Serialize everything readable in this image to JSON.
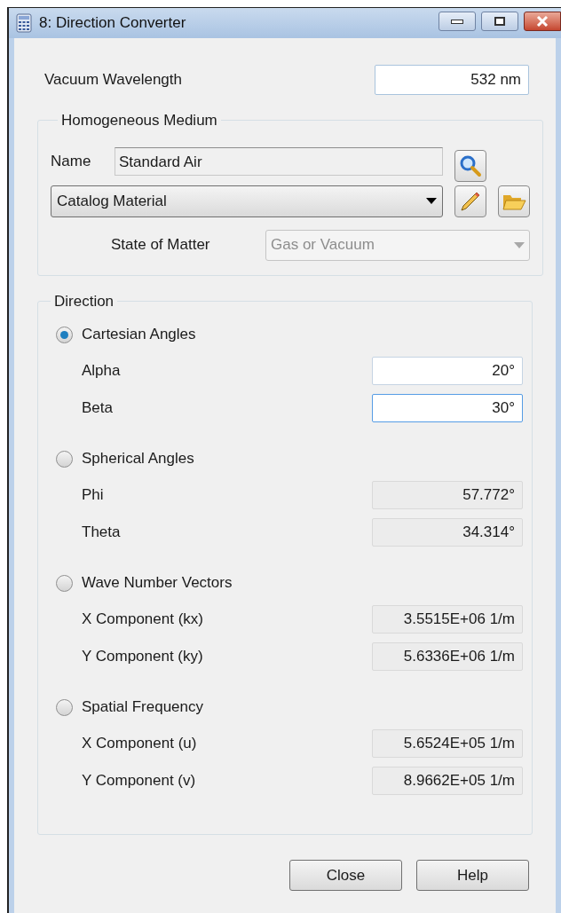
{
  "window": {
    "title": "8: Direction Converter"
  },
  "wavelength": {
    "label": "Vacuum Wavelength",
    "value": "532 nm"
  },
  "medium": {
    "title": "Homogeneous Medium",
    "name_label": "Name",
    "name_value": "Standard Air",
    "source": "Catalog Material",
    "state_label": "State of Matter",
    "state_value": "Gas or Vacuum",
    "state_disabled": true
  },
  "direction": {
    "title": "Direction",
    "groups": [
      {
        "label": "Cartesian Angles",
        "selected": true,
        "rows": [
          {
            "label": "Alpha",
            "value": "20°",
            "editable": true,
            "focused": false
          },
          {
            "label": "Beta",
            "value": "30°",
            "editable": true,
            "focused": true
          }
        ]
      },
      {
        "label": "Spherical Angles",
        "selected": false,
        "rows": [
          {
            "label": "Phi",
            "value": "57.772°",
            "editable": false,
            "focused": false
          },
          {
            "label": "Theta",
            "value": "34.314°",
            "editable": false,
            "focused": false
          }
        ]
      },
      {
        "label": "Wave Number Vectors",
        "selected": false,
        "rows": [
          {
            "label": "X Component (kx)",
            "value": "3.5515E+06 1/m",
            "editable": false,
            "focused": false
          },
          {
            "label": "Y Component (ky)",
            "value": "5.6336E+06 1/m",
            "editable": false,
            "focused": false
          }
        ]
      },
      {
        "label": "Spatial Frequency",
        "selected": false,
        "rows": [
          {
            "label": "X Component (u)",
            "value": "5.6524E+05 1/m",
            "editable": false,
            "focused": false
          },
          {
            "label": "Y Component (v)",
            "value": "8.9662E+05 1/m",
            "editable": false,
            "focused": false
          }
        ]
      }
    ]
  },
  "buttons": [
    "Close",
    "Help"
  ]
}
